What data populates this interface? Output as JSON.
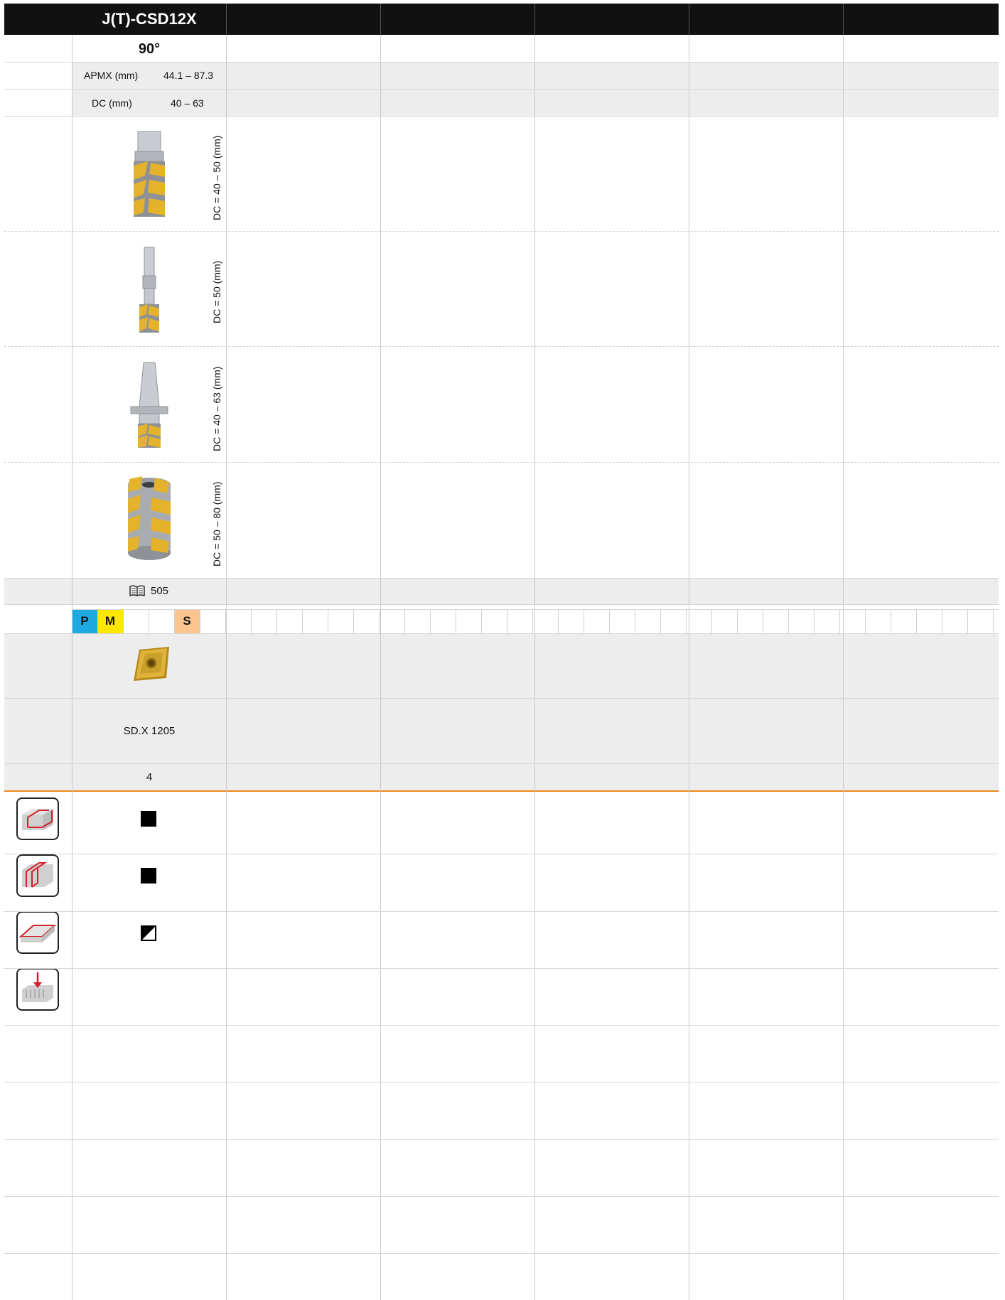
{
  "header": {
    "title": "J(T)-CSD12X",
    "angle": "90°"
  },
  "specs": [
    {
      "label": "APMX  (mm)",
      "value": "44.1 – 87.3"
    },
    {
      "label": "DC (mm)",
      "value": "40 – 63"
    }
  ],
  "holders": [
    {
      "icon": "end-mill-weldon-shank-icon",
      "dc_label": "DC = 40 – 50 (mm)"
    },
    {
      "icon": "long-shank-end-mill-icon",
      "dc_label": "DC = 50 (mm)"
    },
    {
      "icon": "taper-shank-end-mill-icon",
      "dc_label": "DC = 40 – 63 (mm)"
    },
    {
      "icon": "shell-mill-icon",
      "dc_label": "DC = 50 – 80 (mm)"
    }
  ],
  "page_ref": {
    "icon": "book-icon",
    "page": "505"
  },
  "materials": [
    {
      "letter": "P",
      "color": "#1fa9e1"
    },
    {
      "letter": "M",
      "color": "#ffe600"
    },
    {
      "letter": "",
      "color": "#ffffff"
    },
    {
      "letter": "",
      "color": "#ffffff"
    },
    {
      "letter": "S",
      "color": "#fcc48f"
    }
  ],
  "insert": {
    "icon": "square-insert-icon",
    "name": "SD.X 1205",
    "count": "4"
  },
  "operations": [
    {
      "icon": "shoulder-milling-icon",
      "suitability": "full"
    },
    {
      "icon": "slot-milling-icon",
      "suitability": "full"
    },
    {
      "icon": "face-milling-icon",
      "suitability": "partial"
    },
    {
      "icon": "plunge-milling-icon",
      "suitability": ""
    }
  ],
  "colors": {
    "accent": "#f08a1c",
    "header": "#111111",
    "grey_row": "#ededed"
  }
}
